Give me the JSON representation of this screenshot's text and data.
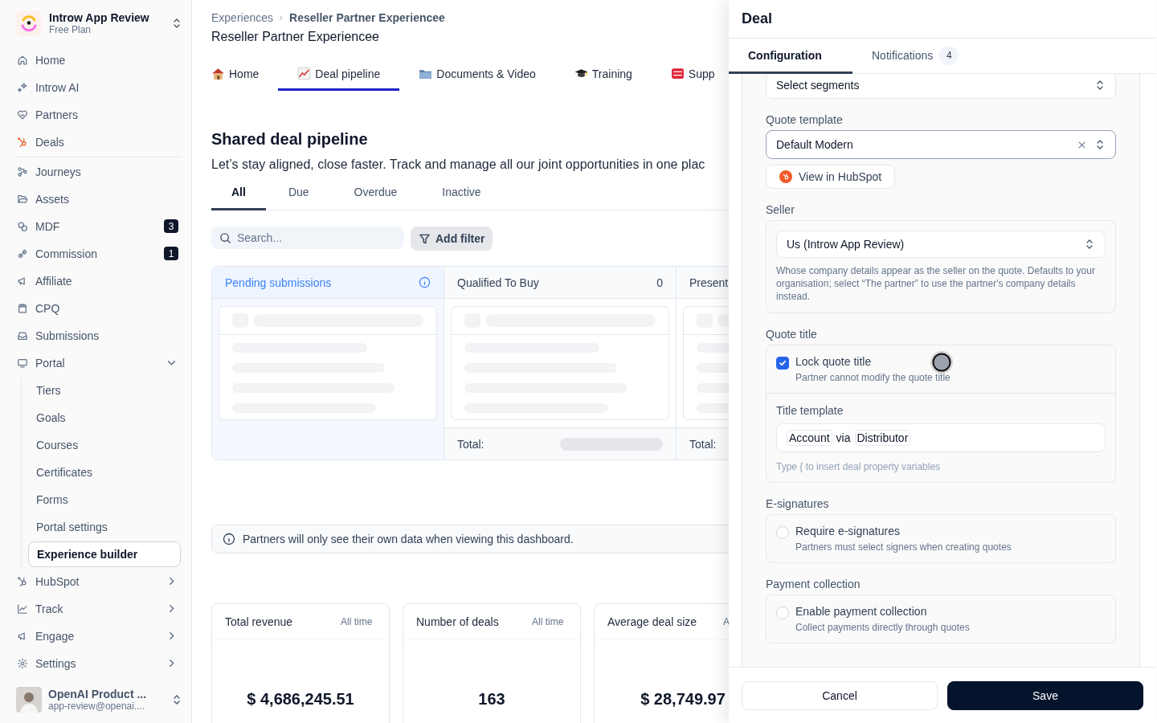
{
  "sidebar": {
    "workspace": {
      "name": "Introw App Review",
      "plan": "Free Plan"
    },
    "sections": [
      [
        {
          "label": "Home",
          "selected": false
        },
        {
          "label": "Introw AI",
          "selected": false
        },
        {
          "label": "Partners",
          "selected": false
        },
        {
          "label": "Deals",
          "selected": false
        }
      ],
      [
        {
          "label": "Journeys",
          "selected": false
        },
        {
          "label": "Assets",
          "selected": false
        },
        {
          "label": "MDF",
          "badge": "3",
          "selected": false
        },
        {
          "label": "Commission",
          "badge": "1",
          "selected": false
        },
        {
          "label": "Affiliate",
          "selected": false
        },
        {
          "label": "CPQ",
          "selected": false
        },
        {
          "label": "Submissions",
          "selected": false
        },
        {
          "label": "Portal",
          "selected": false,
          "expanded": true,
          "children": [
            {
              "label": "Tiers",
              "selected": false
            },
            {
              "label": "Goals",
              "selected": false
            },
            {
              "label": "Courses",
              "selected": false
            },
            {
              "label": "Certificates",
              "selected": false
            },
            {
              "label": "Forms",
              "selected": false
            },
            {
              "label": "Portal settings",
              "selected": false
            },
            {
              "label": "Experience builder",
              "selected": true
            }
          ]
        },
        {
          "label": "HubSpot",
          "selected": false,
          "expanded": false
        },
        {
          "label": "Track",
          "selected": false,
          "expanded": false
        },
        {
          "label": "Engage",
          "selected": false,
          "expanded": false
        },
        {
          "label": "Settings",
          "selected": false,
          "expanded": false
        }
      ]
    ],
    "user": {
      "name": "OpenAI Product ...",
      "email": "app-review@openai...."
    }
  },
  "breadcrumb": [
    "Experiences",
    "Reseller Partner Experiencee"
  ],
  "page_title": "Reseller Partner Experiencee",
  "tabs": [
    {
      "label": "Home",
      "selected": false
    },
    {
      "label": "Deal pipeline",
      "selected": true
    },
    {
      "label": "Documents & Video",
      "selected": false
    },
    {
      "label": "Training",
      "selected": false
    },
    {
      "label": "Supp",
      "selected": false
    }
  ],
  "section": {
    "heading": "Shared deal pipeline",
    "description": "Let’s stay aligned, close faster. Track and manage all our joint opportunities in one plac"
  },
  "filter_tabs": [
    {
      "label": "All",
      "selected": true
    },
    {
      "label": "Due",
      "selected": false
    },
    {
      "label": "Overdue",
      "selected": false
    },
    {
      "label": "Inactive",
      "selected": false
    }
  ],
  "search": {
    "placeholder": "Search..."
  },
  "add_filter": "Add filter",
  "columns": [
    {
      "kind": "pending",
      "title": "Pending submissions"
    },
    {
      "kind": "stage",
      "title": "Qualified To Buy",
      "count": "0",
      "total_label": "Total:",
      "total_loading": true
    },
    {
      "kind": "stage",
      "title": "Present",
      "total_label": "Total:"
    }
  ],
  "notice": "Partners will only see their own data when viewing this dashboard.",
  "stats": [
    {
      "title": "Total revenue",
      "period": "All time",
      "value": "$ 4,686,245.51"
    },
    {
      "title": "Number of deals",
      "period": "All time",
      "value": "163"
    },
    {
      "title": "Average deal size",
      "period": "A",
      "value": "$ 28,749.97"
    }
  ],
  "drawer": {
    "title": "Deal",
    "tabs": [
      {
        "label": "Configuration",
        "selected": true
      },
      {
        "label": "Notifications",
        "badge": "4",
        "selected": false
      }
    ],
    "fields": [
      {
        "kind": "select",
        "value": "Select segments"
      },
      {
        "kind": "select",
        "label": "Quote template",
        "value": "Default Modern",
        "clearable": true,
        "link": "View in HubSpot"
      },
      {
        "kind": "seller",
        "label": "Seller",
        "value": "Us (Introw App Review)",
        "help": "Whose company details appear as the seller on the quote. Defaults to your organisation; select “The partner” to use the partner's company details instead."
      },
      {
        "kind": "quote_title",
        "label": "Quote title",
        "option": {
          "label": "Lock quote title",
          "description": "Partner cannot modify the quote title",
          "checked": true
        },
        "template_label": "Title template",
        "tokens": [
          {
            "kind": "token",
            "text": "Account"
          },
          {
            "kind": "text",
            "text": "via"
          },
          {
            "kind": "token",
            "text": "Distributor"
          }
        ],
        "hint": "Type { to insert deal property variables"
      },
      {
        "kind": "option",
        "label": "E-signatures",
        "option": {
          "label": "Require e-signatures",
          "description": "Partners must select signers when creating quotes",
          "checked": false
        }
      },
      {
        "kind": "option",
        "label": "Payment collection",
        "option": {
          "label": "Enable payment collection",
          "description": "Collect payments directly through quotes",
          "checked": false
        }
      }
    ],
    "buttons": [
      "Cancel",
      "Save"
    ]
  }
}
